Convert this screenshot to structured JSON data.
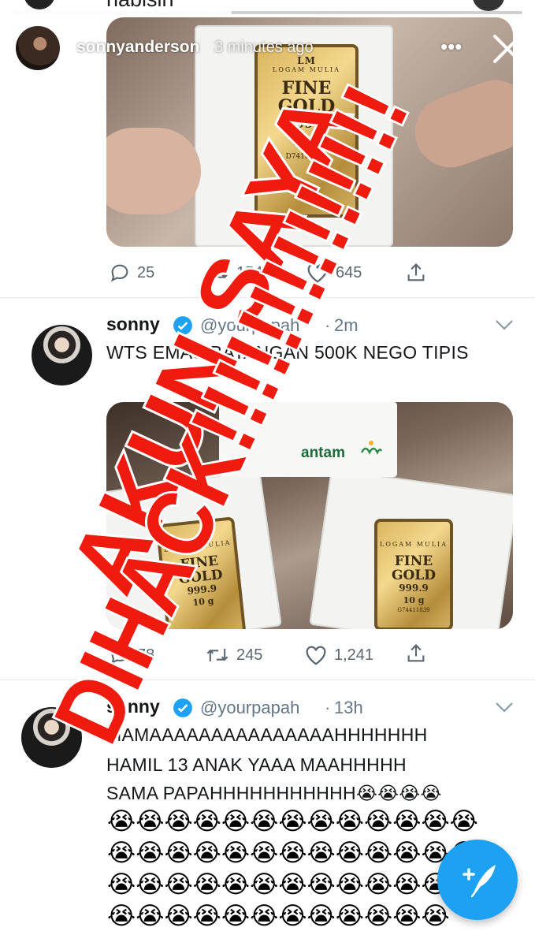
{
  "story": {
    "previous_text": "nabisin",
    "username": "sonnyanderson",
    "time": "3 minutes ago",
    "progress": 0.43
  },
  "tweets": [
    {
      "media_labels": {
        "brand": "LM",
        "brand_sub": "LOGAM MULIA",
        "title_line1": "FINE",
        "title_line2": "GOLD",
        "purity": "999.9",
        "weight": "25 g",
        "serial": "D74185321"
      },
      "replies": "25",
      "retweets": "154",
      "likes": "645"
    },
    {
      "name": "sonny",
      "handle": "@yourpapah",
      "time": "2m",
      "text": "WTS EMAS BATANGAN 500K NEGO TIPIS",
      "media_labels": {
        "antam": "antam",
        "bar_brand_sub": "LOGAM MULIA",
        "title_line1": "FINE",
        "title_line2": "GOLD",
        "purity": "999.9",
        "weight": "10 g",
        "serial": "G74411839"
      },
      "replies": "78",
      "retweets": "245",
      "likes": "1,241"
    },
    {
      "name": "sonny",
      "handle": "@yourpapah",
      "time": "13h",
      "text_lines": [
        "MAMAAAAAAAAAAAAAAAHHHHHHH",
        "HAMIL 13 ANAK YAAA MAAHHHHH",
        "SAMA PAPAHHHHHHHHHHH😭😭😭😭"
      ],
      "emoji_rows": [
        "😭😭😭😭😭😭😭😭😭😭😭😭😭",
        "😭😭😭😭😭😭😭😭😭😭😭😭😭",
        "😭😭😭😭😭😭😭😭😭😭😭😭",
        "😭😭😭😭😭😭😭😭😭😭😭😭",
        "😭😭😭😭😭😭😭😭😭😭😭😭"
      ]
    }
  ],
  "overlay": {
    "line1": "AKUN SAYA",
    "line2": "DIHACK!!!!!!!!!!!!!!",
    "color": "#f01b0f"
  },
  "colors": {
    "twitter_blue": "#1da1f2",
    "text_primary": "#14171a",
    "text_secondary": "#657786"
  },
  "icons": [
    "reply-icon",
    "retweet-icon",
    "like-icon",
    "share-icon",
    "verified-icon",
    "caret-down-icon",
    "close-icon",
    "compose-icon",
    "more-icon"
  ]
}
